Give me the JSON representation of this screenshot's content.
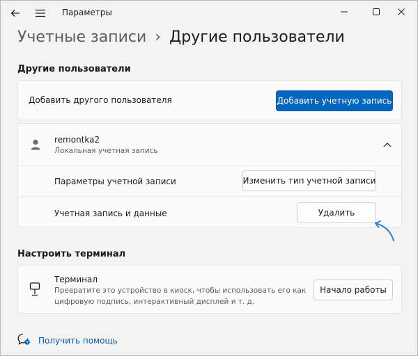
{
  "window": {
    "app_title": "Параметры",
    "icons": {
      "back": "back-arrow-icon",
      "menu": "hamburger-menu-icon",
      "minimize": "minimize-icon",
      "maximize": "maximize-icon",
      "close": "close-icon"
    }
  },
  "header": {
    "breadcrumb_parent": "Учетные записи",
    "breadcrumb_separator": "›",
    "breadcrumb_current": "Другие пользователи"
  },
  "other_users": {
    "section_title": "Другие пользователи",
    "add_user_label": "Добавить другого пользователя",
    "add_account_button": "Добавить учетную запись",
    "user": {
      "name": "remontka2",
      "type": "Локальная учетная запись",
      "icon": "user-avatar-icon",
      "expand_icon": "chevron-up-icon"
    },
    "account_settings_label": "Параметры учетной записи",
    "change_type_button": "Изменить тип учетной записи",
    "account_data_label": "Учетная запись и данные",
    "delete_button": "Удалить"
  },
  "kiosk": {
    "section_title": "Настроить терминал",
    "title": "Терминал",
    "description_line1": "Превратите это устройство в киоск, чтобы использовать его как",
    "description_line2": "цифровую подпись, интерактивный дисплей и т. д.",
    "start_button": "Начало работы",
    "icon": "kiosk-icon"
  },
  "help": {
    "label": "Получить помощь",
    "icon": "help-chat-icon"
  },
  "colors": {
    "accent": "#0067c0",
    "annotation_arrow": "#2f7fcf"
  }
}
